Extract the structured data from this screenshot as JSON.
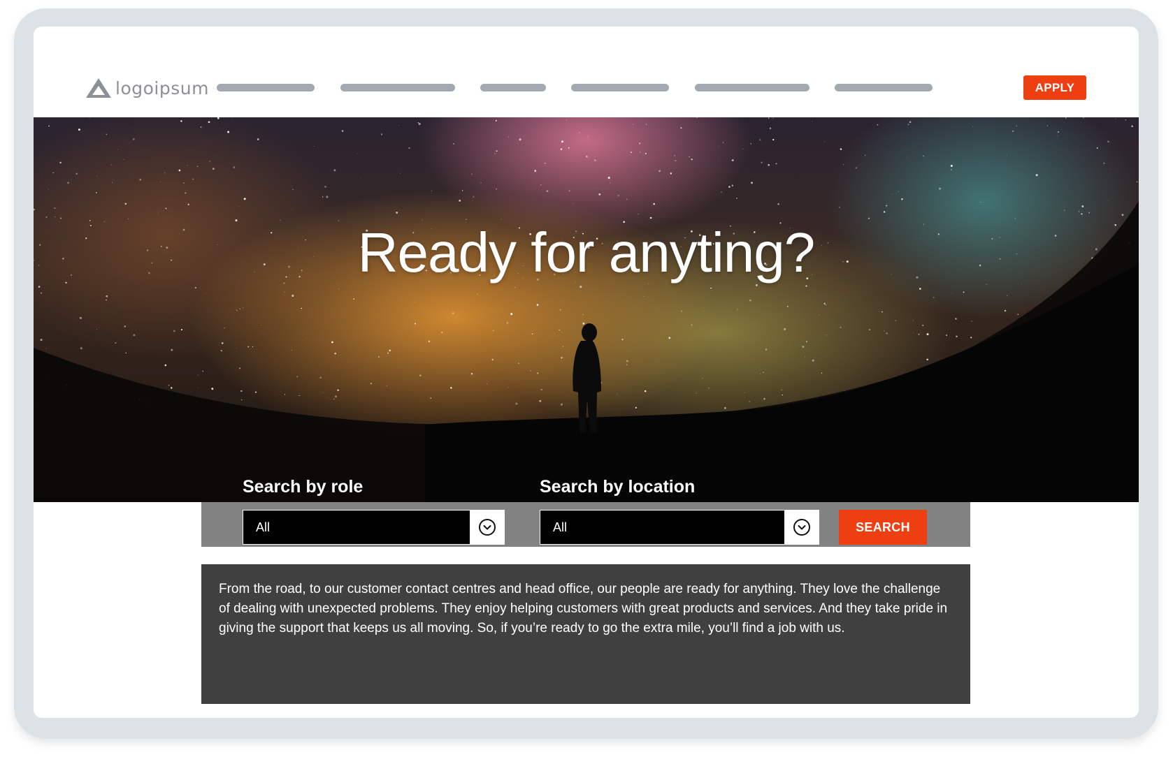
{
  "header": {
    "logo_text": "logoipsum",
    "logo_icon": "triangle-logo-icon",
    "nav_links": [
      {
        "label": ""
      },
      {
        "label": ""
      },
      {
        "label": ""
      },
      {
        "label": ""
      },
      {
        "label": ""
      },
      {
        "label": ""
      }
    ],
    "apply_label": "APPLY"
  },
  "hero": {
    "title": "Ready for anyting?"
  },
  "search": {
    "role_label": "Search by role",
    "role_value": "All",
    "location_label": "Search by location",
    "location_value": "All",
    "button_label": "SEARCH",
    "dropdown_icon": "chevron-down-circle-icon"
  },
  "intro": {
    "text": "From the road, to our customer contact centres and head office, our people are ready for anything. They love the challenge of dealing with unexpected problems. They enjoy helping customers with great products and services. And they take pride in giving the support that keeps us all moving. So, if you’re ready to go the extra mile, you’ll find a job with us."
  },
  "colors": {
    "accent": "#ee3f12",
    "frame": "#dde2e6",
    "nav_placeholder": "#a3a9b0",
    "band": "#828282",
    "panel": "#404040"
  }
}
